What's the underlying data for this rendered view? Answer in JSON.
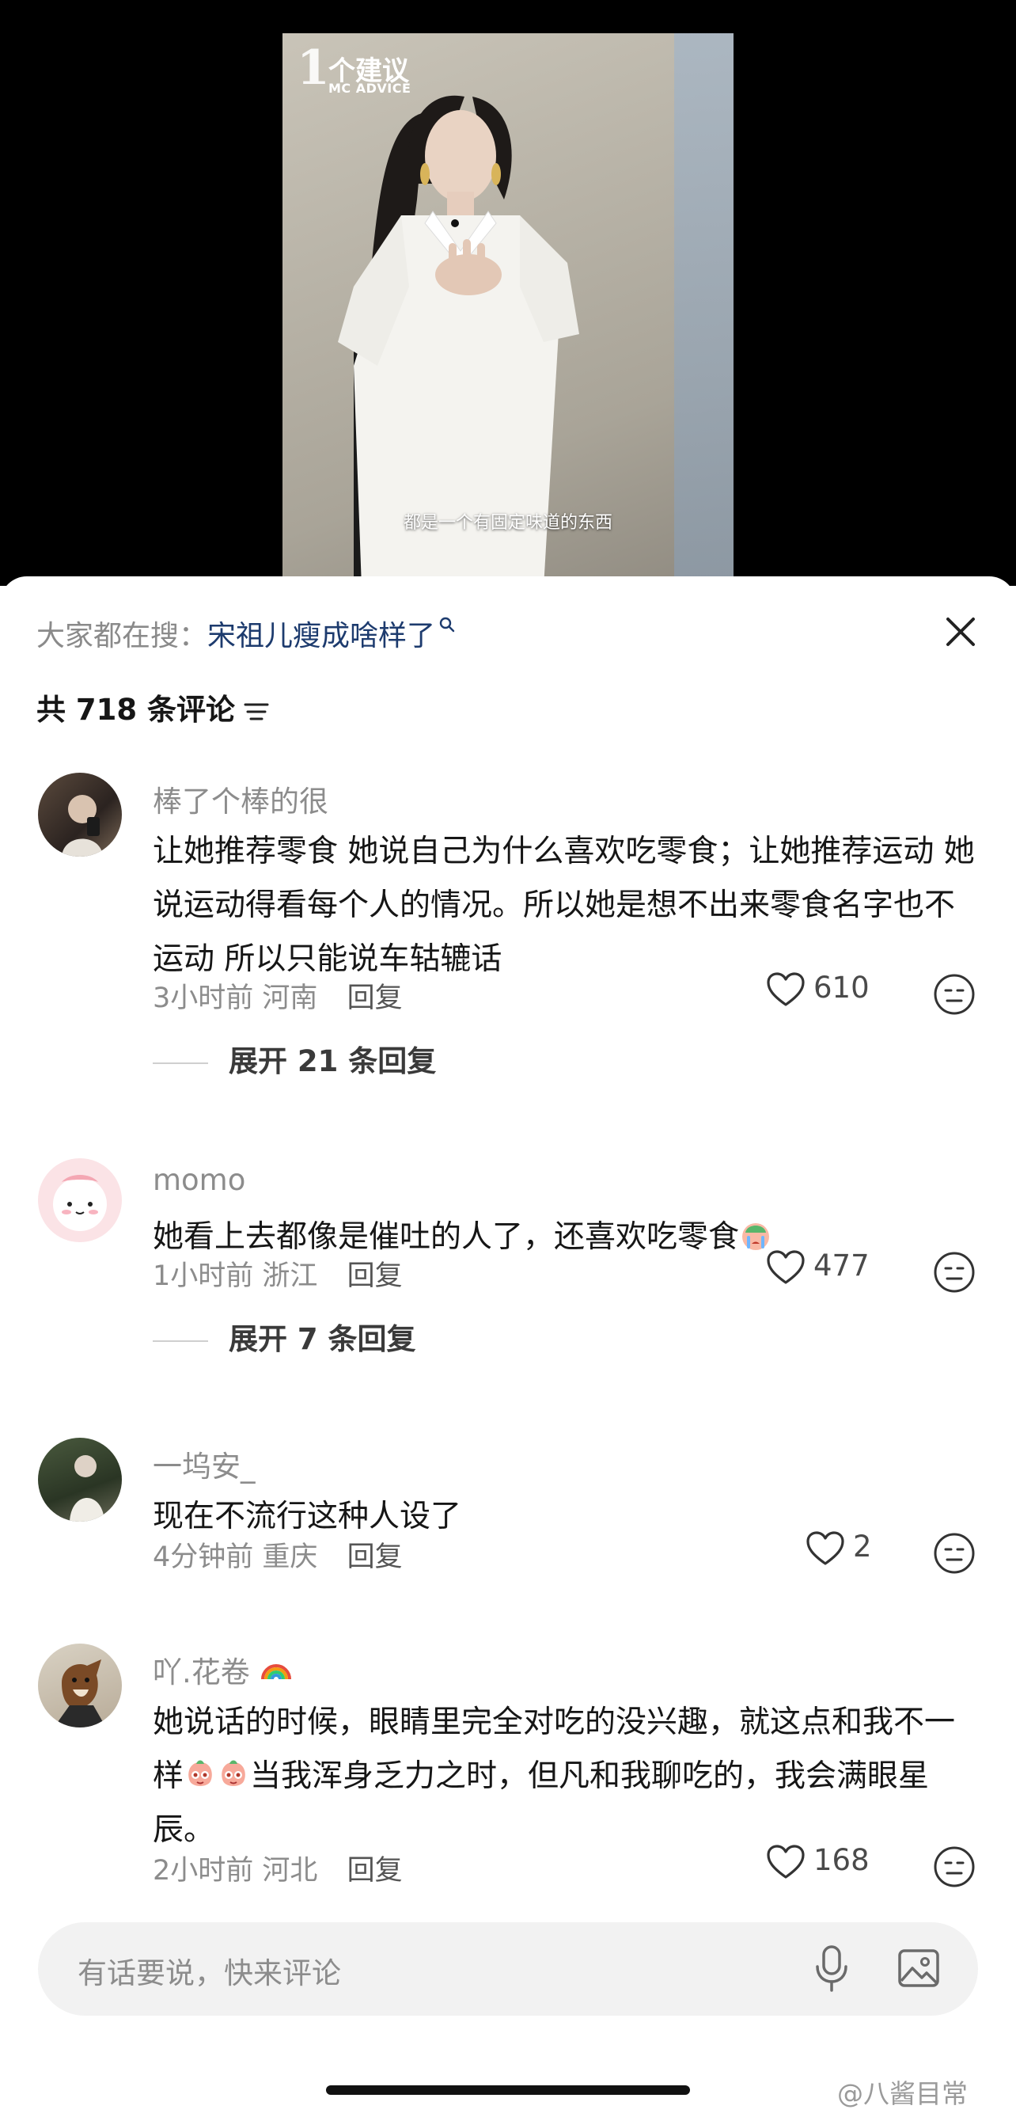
{
  "video": {
    "brand_number": "1",
    "brand_title": "个建议",
    "brand_subtitle": "MC ADVICE",
    "subtitle": "都是一个有固定味道的东西"
  },
  "sheet": {
    "search_prefix": "大家都在搜：",
    "search_term": "宋祖儿瘦成啥样了",
    "comment_count": "共 718 条评论"
  },
  "comments": [
    {
      "username": "棒了个棒的很",
      "text": "让她推荐零食 她说自己为什么喜欢吃零食；让她推荐运动 她说运动得看每个人的情况。所以她是想不出来零食名字也不运动 所以只能说车轱辘话",
      "time": "3小时前",
      "location": "河南",
      "reply": "回复",
      "likes": "610",
      "expand": "展开 21 条回复"
    },
    {
      "username": "momo",
      "text": "她看上去都像是催吐的人了，还喜欢吃零食",
      "time": "1小时前",
      "location": "浙江",
      "reply": "回复",
      "likes": "477",
      "expand": "展开 7 条回复"
    },
    {
      "username": "一坞安_",
      "text": "现在不流行这种人设了",
      "time": "4分钟前",
      "location": "重庆",
      "reply": "回复",
      "likes": "2"
    },
    {
      "username": "吖.花卷",
      "text_part1": "她说话的时候，眼睛里完全对吃的没兴趣，就这点和我不一样",
      "text_part2": "当我浑身乏力之时，但凡和我聊吃的，我会满眼星辰。",
      "time": "2小时前",
      "location": "河北",
      "reply": "回复",
      "likes": "168"
    }
  ],
  "input_bar": {
    "placeholder": "有话要说，快来评论"
  },
  "watermark": "@八酱目常",
  "icons": {
    "close": "close-icon",
    "sort": "sort-icon",
    "search": "search-icon",
    "like": "heart-icon",
    "react": "emoji-face-icon",
    "mic": "microphone-icon",
    "image": "image-icon"
  },
  "colors": {
    "search_term": "#1d3b6e",
    "secondary_text": "#8c8c8c",
    "input_bg": "#f2f2f2"
  }
}
